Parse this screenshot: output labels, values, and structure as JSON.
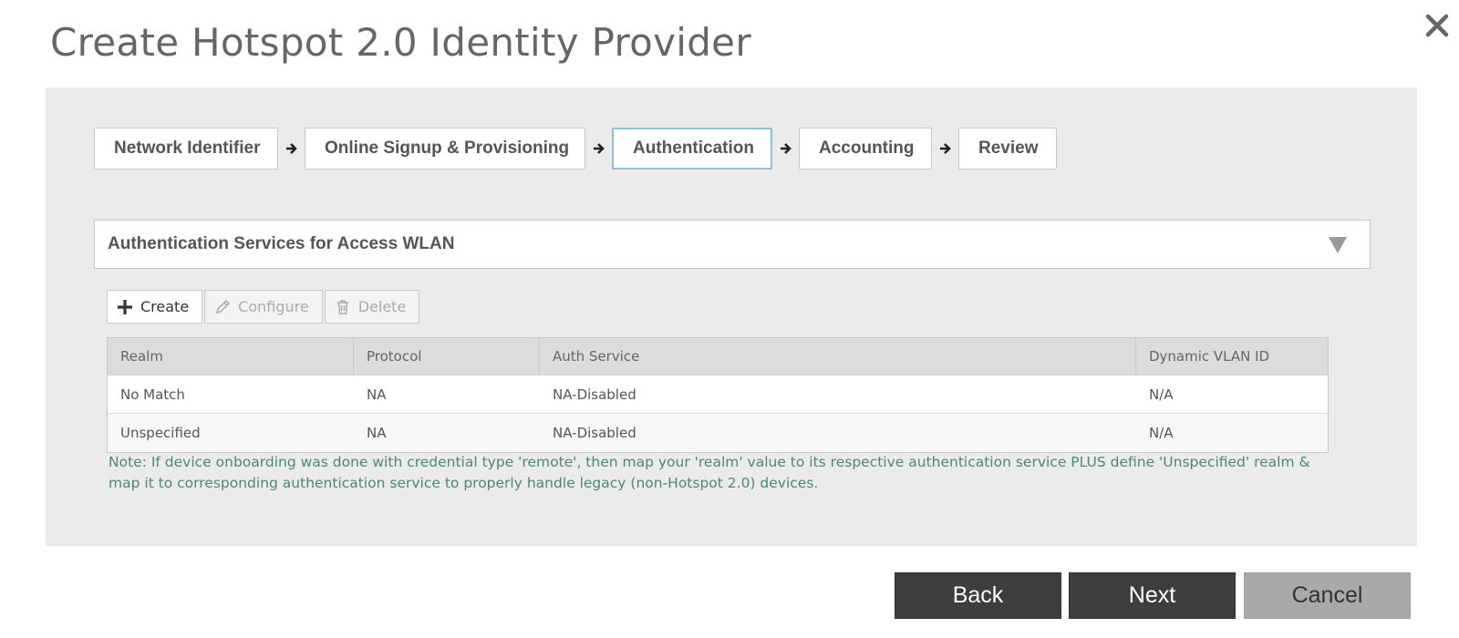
{
  "dialog": {
    "title": "Create Hotspot 2.0 Identity Provider"
  },
  "wizard": {
    "steps": [
      {
        "label": "Network Identifier"
      },
      {
        "label": "Online Signup & Provisioning"
      },
      {
        "label": "Authentication",
        "active": true
      },
      {
        "label": "Accounting"
      },
      {
        "label": "Review"
      }
    ]
  },
  "section": {
    "title": "Authentication Services for Access WLAN",
    "icon": "caret-down-icon"
  },
  "toolbar": {
    "create_label": "Create",
    "configure_label": "Configure",
    "delete_label": "Delete"
  },
  "table": {
    "columns": [
      "Realm",
      "Protocol",
      "Auth Service",
      "Dynamic VLAN ID"
    ],
    "rows": [
      [
        "No Match",
        "NA",
        "NA-Disabled",
        "N/A"
      ],
      [
        "Unspecified",
        "NA",
        "NA-Disabled",
        "N/A"
      ]
    ]
  },
  "note": "Note: If device onboarding was done with credential type 'remote', then map your 'realm' value to its respective authentication service PLUS define 'Unspecified' realm & map it to corresponding authentication service to properly handle legacy (non-Hotspot 2.0) devices.",
  "footer": {
    "back_label": "Back",
    "next_label": "Next",
    "cancel_label": "Cancel"
  },
  "colors": {
    "active_step_border": "#8cc2d6",
    "note_text": "#4b8a6e",
    "primary_button": "#3e3e3e",
    "cancel_button": "#a9a9a9"
  }
}
